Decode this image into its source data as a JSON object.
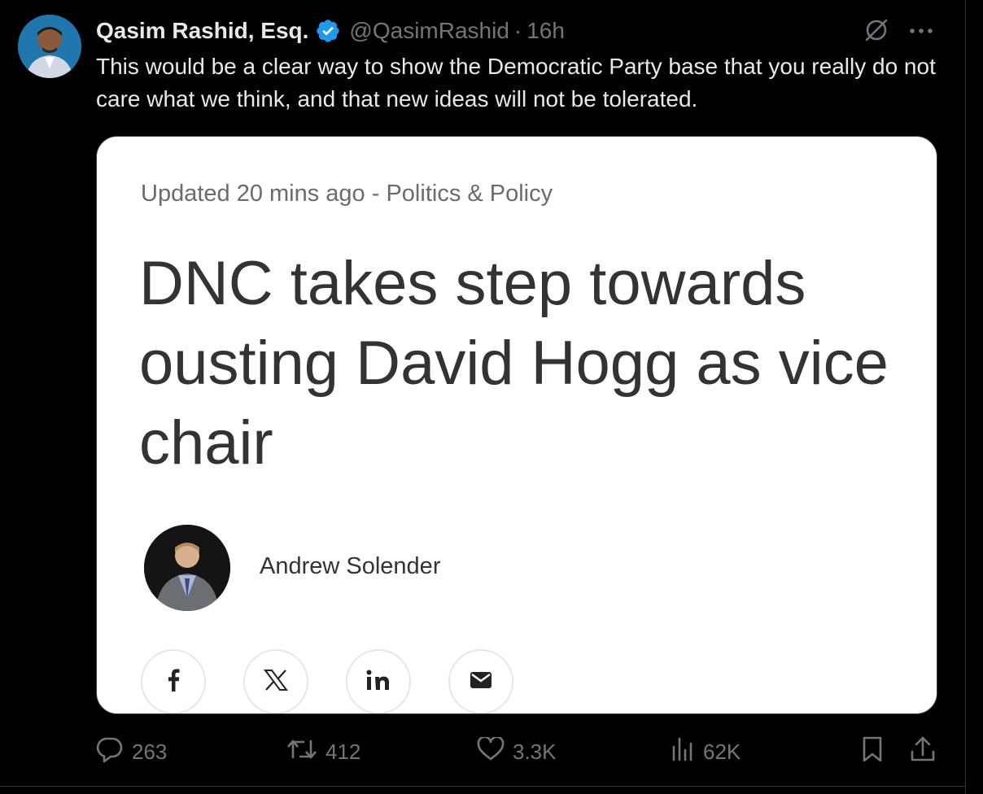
{
  "author": {
    "name": "Qasim Rashid, Esq.",
    "handle": "@QasimRashid",
    "separator": "·",
    "time": "16h"
  },
  "tweet": {
    "text": "This would be a clear way to show the Democratic Party base that you really do not care what we think, and that new ideas will not be tolerated."
  },
  "card": {
    "meta": "Updated 20 mins ago - Politics & Policy",
    "headline": "DNC takes step towards ousting David Hogg as vice chair",
    "author": "Andrew Solender",
    "share_icons": [
      "facebook-icon",
      "x-icon",
      "linkedin-icon",
      "mail-icon"
    ]
  },
  "stats": {
    "replies": "263",
    "reposts": "412",
    "likes": "3.3K",
    "views": "62K"
  },
  "colors": {
    "background": "#000000",
    "text_primary": "#e7e9ea",
    "text_secondary": "#71767b",
    "verified_blue": "#1d9bf0",
    "card_background": "#ffffff",
    "card_text": "#333333"
  }
}
